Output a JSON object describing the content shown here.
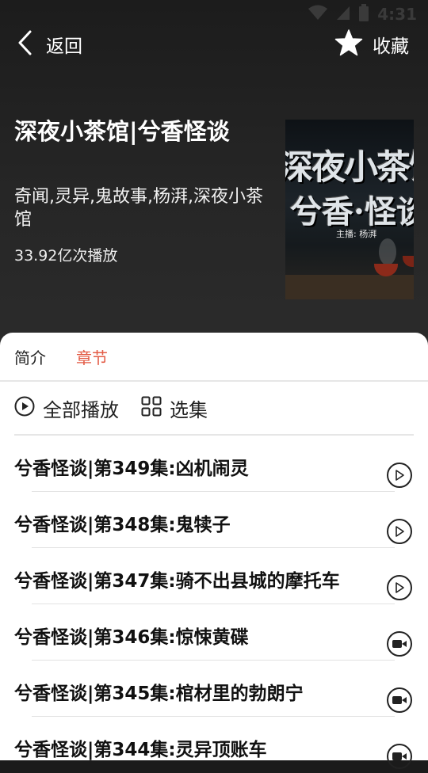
{
  "status_bar": {
    "time": "4:31"
  },
  "header": {
    "back_label": "返回",
    "favorite_label": "收藏"
  },
  "album": {
    "title": "深夜小茶馆|兮香怪谈",
    "tags": "奇闻,灵异,鬼故事,杨湃,深夜小茶馆",
    "play_count": "33.92亿次播放",
    "cover": {
      "line1": "深夜小茶馆",
      "line2": "兮香·怪谈",
      "host": "主播: 杨湃"
    }
  },
  "tabs": [
    {
      "label": "简介",
      "active": false
    },
    {
      "label": "章节",
      "active": true
    }
  ],
  "actions": {
    "play_all": "全部播放",
    "select_episodes": "选集"
  },
  "episodes": [
    {
      "title": "兮香怪谈|第349集:凶机闹灵",
      "icon": "play-circle-icon"
    },
    {
      "title": "兮香怪谈|第348集:鬼犊子",
      "icon": "play-circle-icon"
    },
    {
      "title": "兮香怪谈|第347集:骑不出县城的摩托车",
      "icon": "play-circle-icon"
    },
    {
      "title": "兮香怪谈|第346集:惊悚黄碟",
      "icon": "video-camera-icon"
    },
    {
      "title": "兮香怪谈|第345集:棺材里的勃朗宁",
      "icon": "video-camera-icon"
    },
    {
      "title": "兮香怪谈|第344集:灵异顶账车",
      "icon": "video-camera-icon"
    }
  ],
  "colors": {
    "accent": "#e35b45",
    "hero_bg": "#262626"
  }
}
